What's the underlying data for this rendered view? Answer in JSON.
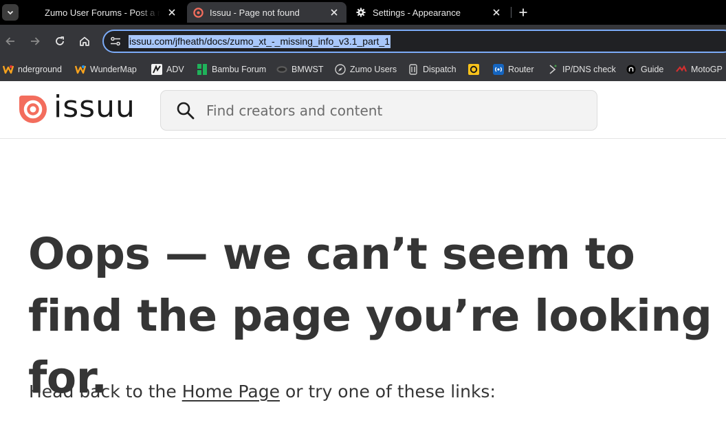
{
  "browser": {
    "tabs": [
      {
        "title": "Zumo User Forums - Post a reply",
        "active": false
      },
      {
        "title": "Issuu - Page not found",
        "active": true
      },
      {
        "title": "Settings - Appearance",
        "active": false
      }
    ],
    "url": "issuu.com/jfheath/docs/zumo_xt_-_missing_info_v3.1_part_1",
    "bookmarks": [
      {
        "label": "nderground",
        "icon": "wunderground-icon"
      },
      {
        "label": "WunderMap",
        "icon": "wundermap-icon"
      },
      {
        "label": "ADV",
        "icon": "adv-icon"
      },
      {
        "label": "Bambu Forum",
        "icon": "bambu-icon"
      },
      {
        "label": "BMWST",
        "icon": "bmwst-icon"
      },
      {
        "label": "Zumo Users",
        "icon": "compass-icon"
      },
      {
        "label": "Dispatch",
        "icon": "dispatch-icon"
      },
      {
        "label": "",
        "icon": "yellow-ring-icon"
      },
      {
        "label": "Router",
        "icon": "router-icon"
      },
      {
        "label": "IP/DNS check",
        "icon": "dns-icon"
      },
      {
        "label": "Guide",
        "icon": "guide-icon"
      },
      {
        "label": "MotoGP",
        "icon": "motogp-icon"
      }
    ]
  },
  "site": {
    "logo_text": "issuu",
    "brand_color": "#f36d5d",
    "search_placeholder": "Find creators and content"
  },
  "main": {
    "heading": "Oops — we can’t seem to find the page you’re looking for.",
    "help_prefix": "Head back to the",
    "home_link": "Home Page",
    "help_suffix": "or try one of these links:"
  }
}
